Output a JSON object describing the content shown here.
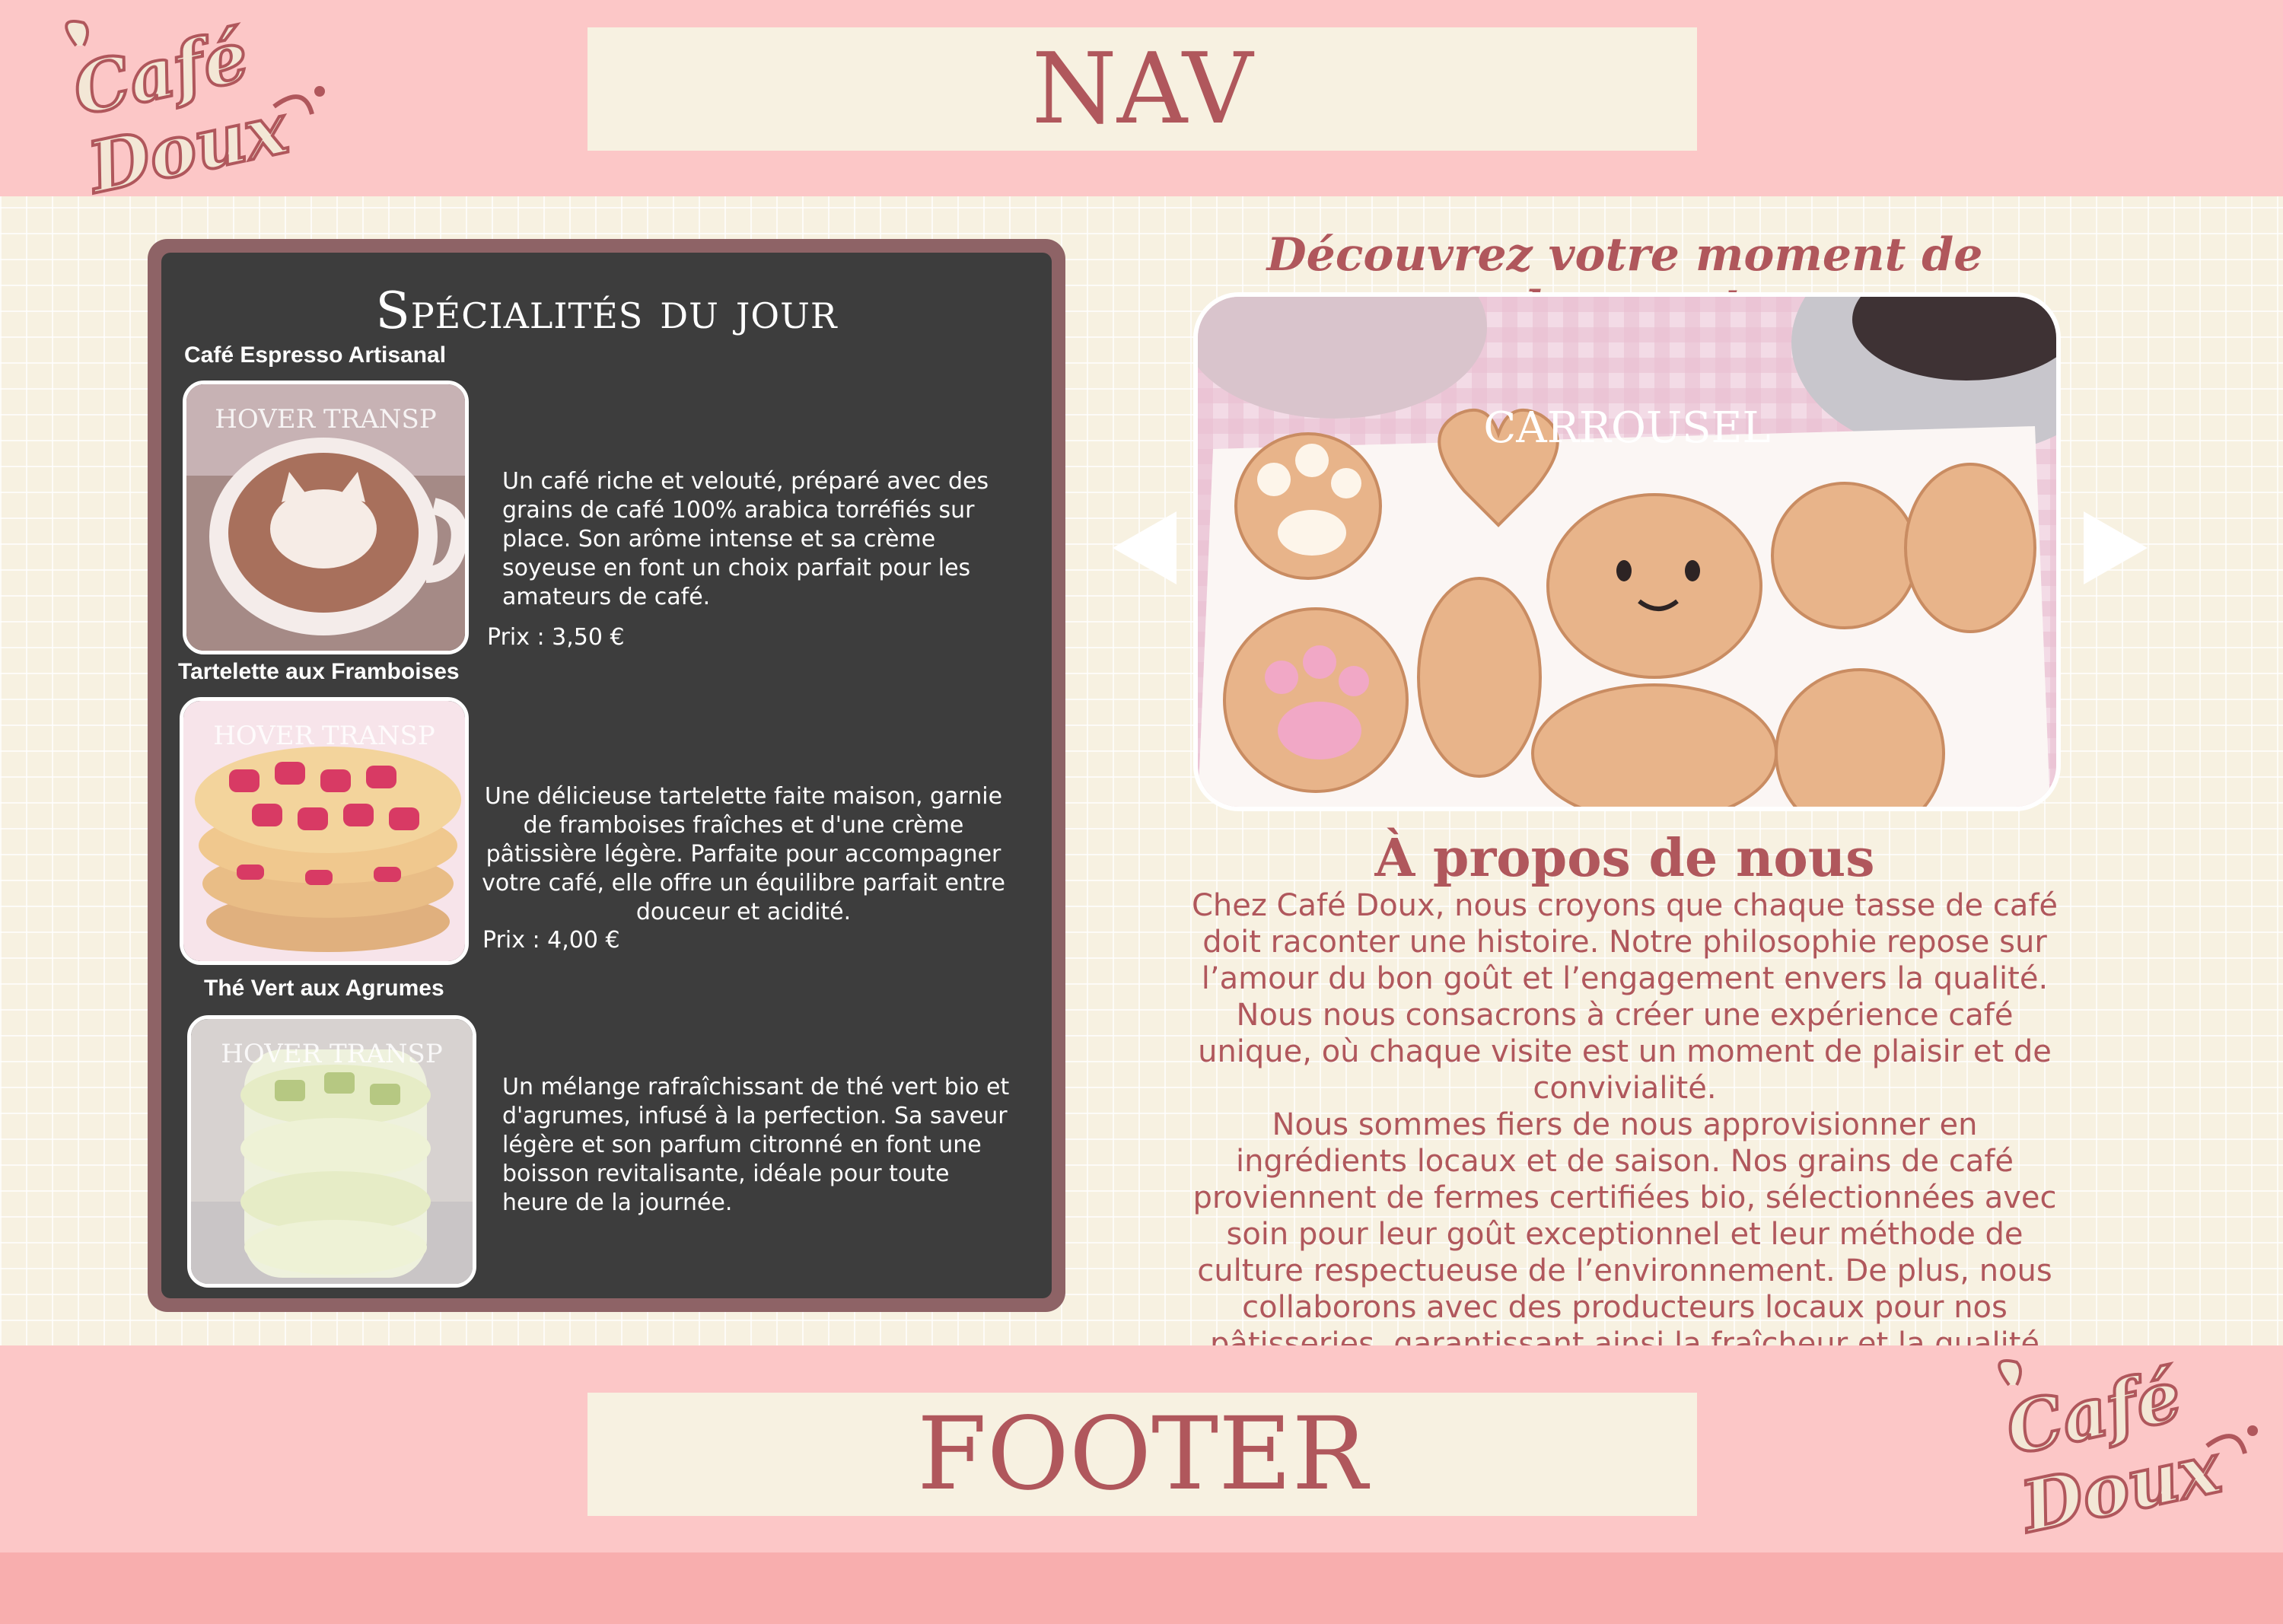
{
  "brand": {
    "logo_text_line1": "Café",
    "logo_text_line2": "Doux"
  },
  "nav": {
    "label": "NAV"
  },
  "footer": {
    "label": "FOOTER"
  },
  "specials": {
    "title": "Spécialités du jour",
    "hover_label": "HOVER TRANSP",
    "items": [
      {
        "name": "Café Espresso Artisanal",
        "description": "Un café riche et velouté, préparé avec des grains de café 100% arabica torréfiés sur place. Son arôme intense et sa crème soyeuse en font un choix parfait pour les amateurs de café.",
        "price": "Prix : 3,50 €"
      },
      {
        "name": "Tartelette aux Framboises",
        "description": "Une délicieuse tartelette faite maison, garnie de framboises fraîches et d'une crème pâtissière légère. Parfaite pour accompagner votre café, elle offre un équilibre parfait entre douceur et acidité.",
        "price": "Prix : 4,00 €"
      },
      {
        "name": "Thé Vert aux Agrumes",
        "description": "Un mélange rafraîchissant de thé vert bio et d'agrumes, infusé à la perfection. Sa saveur légère et son parfum citronné en font une boisson revitalisante, idéale pour toute heure de la journée.",
        "price": ""
      }
    ]
  },
  "hero": {
    "tagline": "Découvrez votre moment de douceur!",
    "carousel_label": "CARROUSEL"
  },
  "about": {
    "title": "À propos de nous",
    "paragraph1": "Chez Café Doux, nous croyons que chaque tasse de café doit raconter une histoire. Notre philosophie repose sur l’amour du bon goût et l’engagement envers la qualité. Nous nous consacrons à créer une expérience café unique, où chaque visite est un moment de plaisir et de convivialité.",
    "paragraph2": "Nous sommes fiers de nous approvisionner en ingrédients locaux et de saison. Nos grains de café proviennent de fermes certifiées bio, sélectionnées avec soin pour leur goût exceptionnel et leur méthode de culture respectueuse de l’environnement. De plus, nous collaborons avec des producteurs locaux pour nos pâtisseries, garantissant ainsi la fraîcheur et la qualité de chaque produit."
  },
  "colors": {
    "band": "#fcc7c7",
    "accent": "#b0575c",
    "cream": "#f7f1e1",
    "panel": "#3d3d3d",
    "panel_frame": "#8e6366"
  },
  "icons": {
    "prev": "chevron-left-icon",
    "next": "chevron-right-icon"
  }
}
